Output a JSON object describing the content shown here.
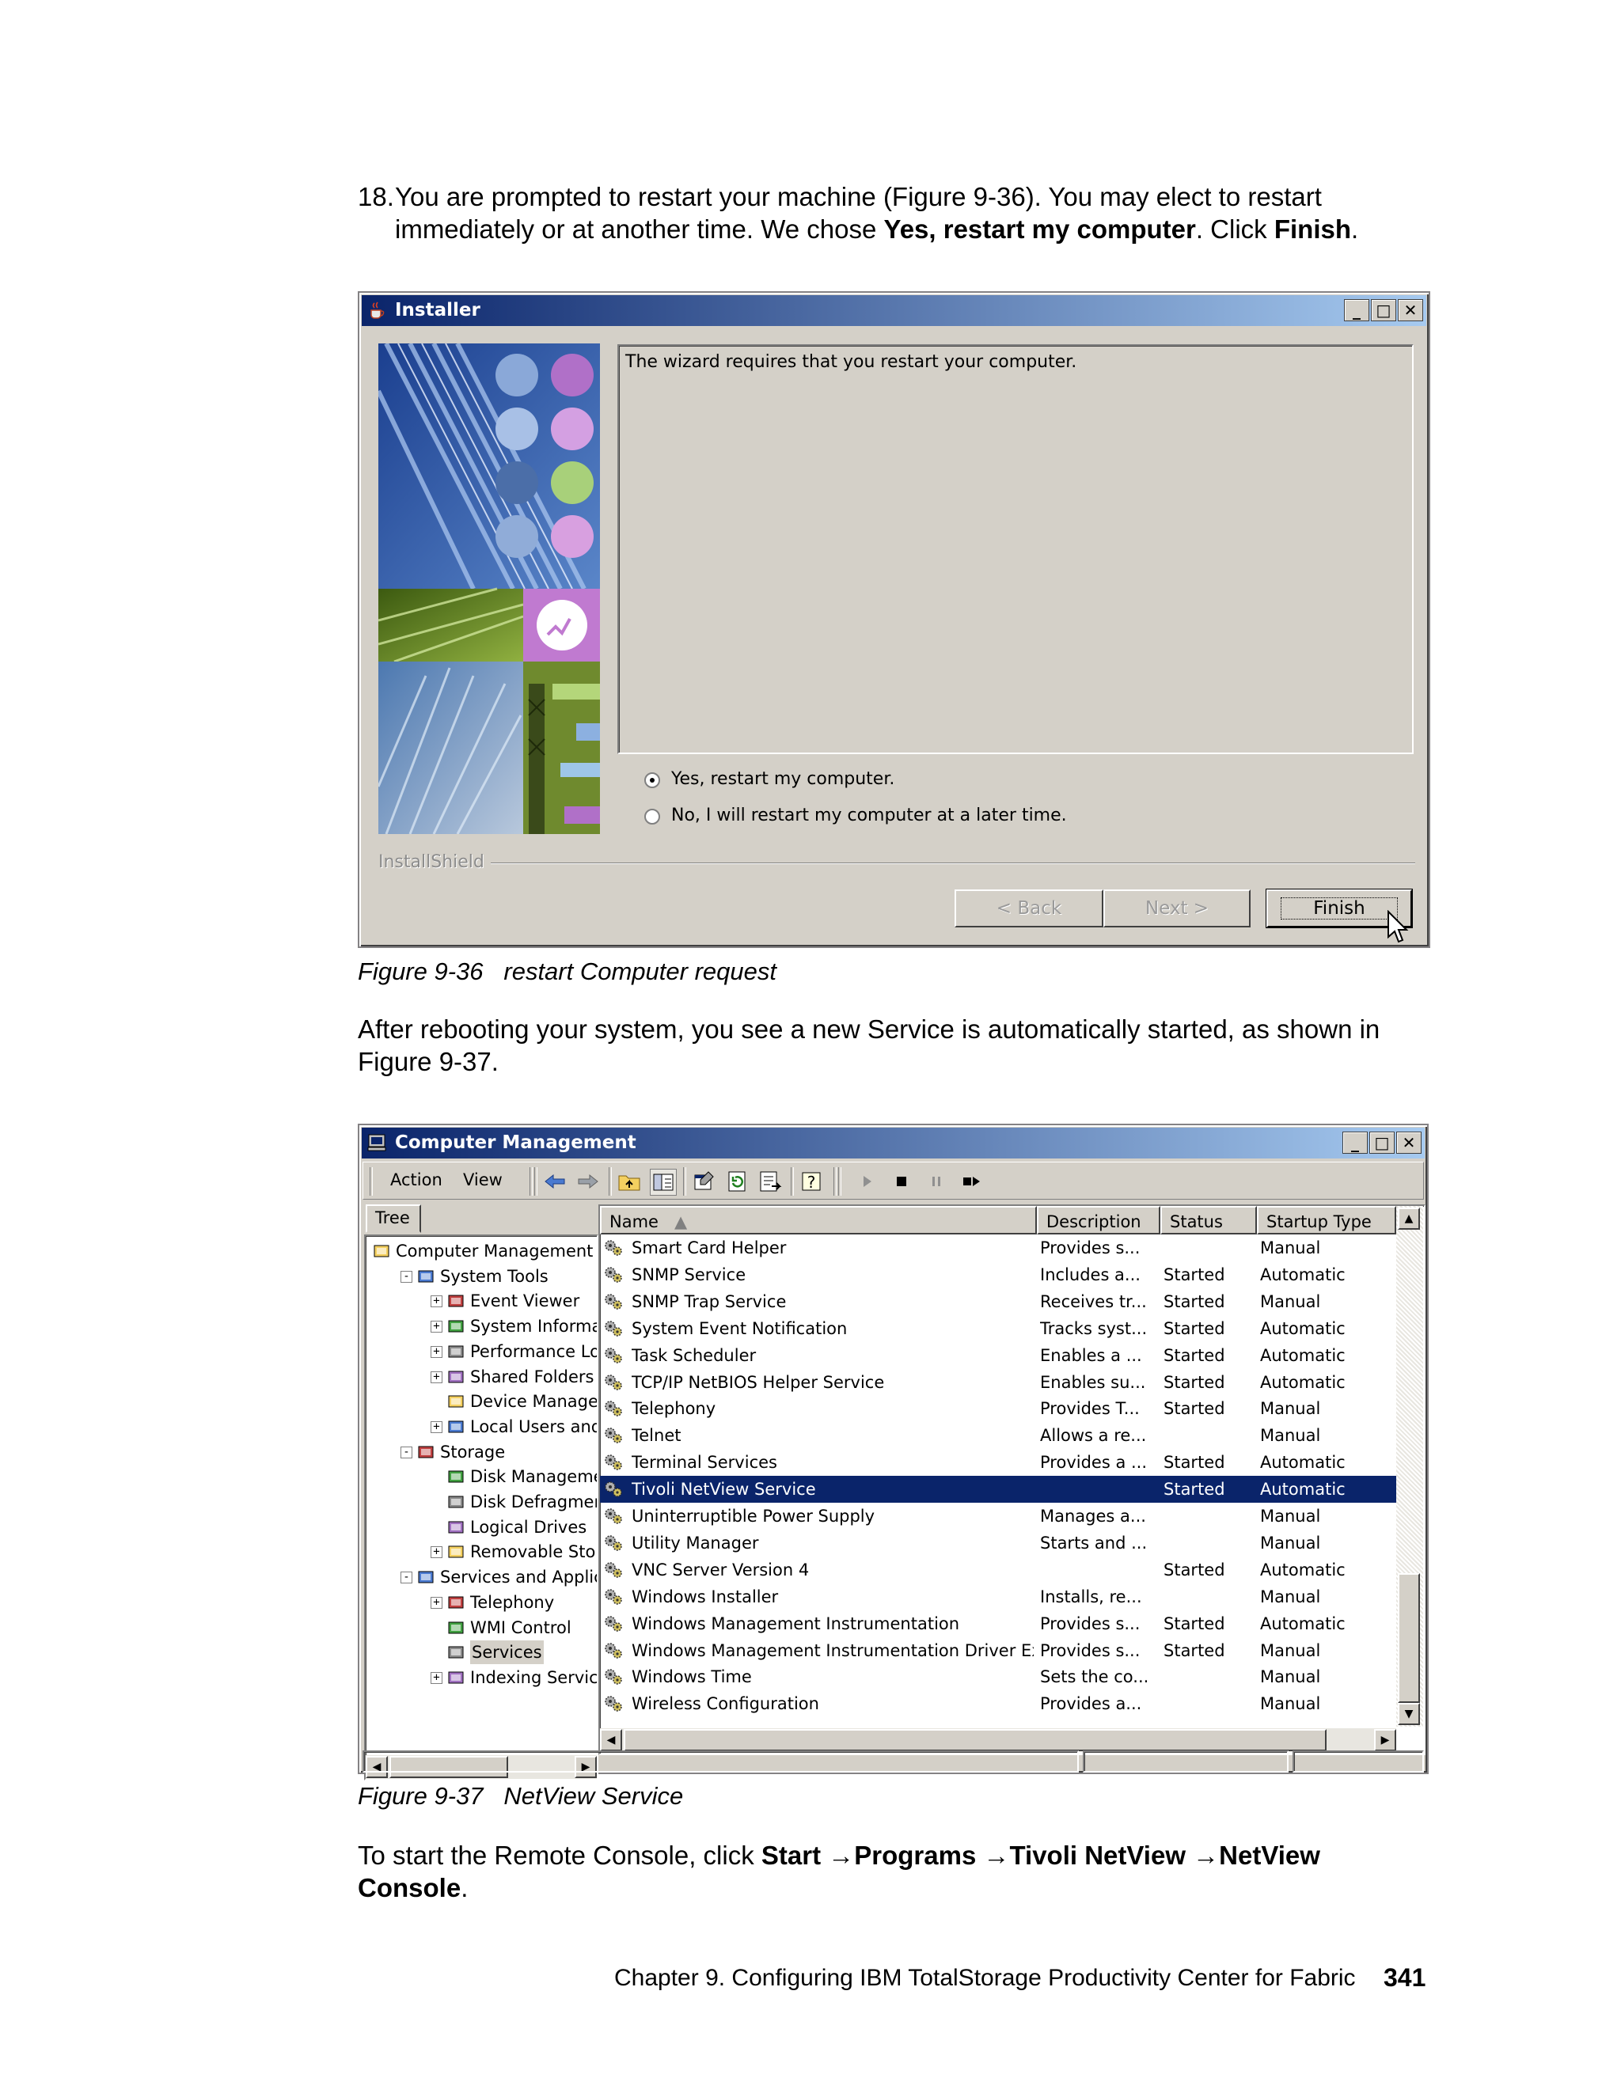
{
  "step18": {
    "number": "18.",
    "line1": "You are prompted to restart your machine (Figure 9-36). You may elect to restart",
    "line2_pre": "immediately or at another time. We chose ",
    "line2_bold": "Yes, restart my computer",
    "line2_mid": ". Click ",
    "line2_bold2": "Finish",
    "line2_end": "."
  },
  "installer": {
    "title": "Installer",
    "message": "The wizard requires that you restart your computer.",
    "radio_yes": "Yes, restart my computer.",
    "radio_no": "No, I will restart my computer at a later time.",
    "brand": "InstallShield",
    "back_label": "< Back",
    "next_label": "Next >",
    "finish_label": "Finish"
  },
  "caption1": {
    "label": "Figure 9-36",
    "text": "restart Computer request"
  },
  "para2": {
    "line1": "After rebooting your system, you see a new Service is automatically started, as shown in",
    "line2": "Figure 9-37."
  },
  "cm": {
    "title": "Computer Management",
    "menu": {
      "action": "Action",
      "view": "View"
    },
    "tree_tab": "Tree",
    "tree": [
      {
        "label": "Computer Management (",
        "level": 0,
        "exp": ""
      },
      {
        "label": "System Tools",
        "level": 1,
        "exp": "-"
      },
      {
        "label": "Event Viewer",
        "level": 2,
        "exp": "+"
      },
      {
        "label": "System Informati",
        "level": 2,
        "exp": "+"
      },
      {
        "label": "Performance Log",
        "level": 2,
        "exp": "+"
      },
      {
        "label": "Shared Folders",
        "level": 2,
        "exp": "+"
      },
      {
        "label": "Device Manager",
        "level": 2,
        "exp": ""
      },
      {
        "label": "Local Users and (",
        "level": 2,
        "exp": "+"
      },
      {
        "label": "Storage",
        "level": 1,
        "exp": "-"
      },
      {
        "label": "Disk Management",
        "level": 2,
        "exp": ""
      },
      {
        "label": "Disk Defragmente",
        "level": 2,
        "exp": ""
      },
      {
        "label": "Logical Drives",
        "level": 2,
        "exp": ""
      },
      {
        "label": "Removable Stora",
        "level": 2,
        "exp": "+"
      },
      {
        "label": "Services and Applicat",
        "level": 1,
        "exp": "-"
      },
      {
        "label": "Telephony",
        "level": 2,
        "exp": "+"
      },
      {
        "label": "WMI Control",
        "level": 2,
        "exp": ""
      },
      {
        "label": "Services",
        "level": 2,
        "exp": "",
        "selected": true
      },
      {
        "label": "Indexing Service",
        "level": 2,
        "exp": "+"
      }
    ],
    "columns": {
      "name": "Name",
      "description": "Description",
      "status": "Status",
      "startup": "Startup Type"
    },
    "rows": [
      {
        "name": "Smart Card Helper",
        "description": "Provides s...",
        "status": "",
        "startup": "Manual"
      },
      {
        "name": "SNMP Service",
        "description": "Includes a...",
        "status": "Started",
        "startup": "Automatic"
      },
      {
        "name": "SNMP Trap Service",
        "description": "Receives tr...",
        "status": "Started",
        "startup": "Manual"
      },
      {
        "name": "System Event Notification",
        "description": "Tracks syst...",
        "status": "Started",
        "startup": "Automatic"
      },
      {
        "name": "Task Scheduler",
        "description": "Enables a ...",
        "status": "Started",
        "startup": "Automatic"
      },
      {
        "name": "TCP/IP NetBIOS Helper Service",
        "description": "Enables su...",
        "status": "Started",
        "startup": "Automatic"
      },
      {
        "name": "Telephony",
        "description": "Provides T...",
        "status": "Started",
        "startup": "Manual"
      },
      {
        "name": "Telnet",
        "description": "Allows a re...",
        "status": "",
        "startup": "Manual"
      },
      {
        "name": "Terminal Services",
        "description": "Provides a ...",
        "status": "Started",
        "startup": "Automatic"
      },
      {
        "name": "Tivoli NetView Service",
        "description": "",
        "status": "Started",
        "startup": "Automatic",
        "selected": true
      },
      {
        "name": "Uninterruptible Power Supply",
        "description": "Manages a...",
        "status": "",
        "startup": "Manual"
      },
      {
        "name": "Utility Manager",
        "description": "Starts and ...",
        "status": "",
        "startup": "Manual"
      },
      {
        "name": "VNC Server Version 4",
        "description": "",
        "status": "Started",
        "startup": "Automatic"
      },
      {
        "name": "Windows Installer",
        "description": "Installs, re...",
        "status": "",
        "startup": "Manual"
      },
      {
        "name": "Windows Management Instrumentation",
        "description": "Provides s...",
        "status": "Started",
        "startup": "Automatic"
      },
      {
        "name": "Windows Management Instrumentation Driver Ext...",
        "description": "Provides s...",
        "status": "Started",
        "startup": "Manual"
      },
      {
        "name": "Windows Time",
        "description": "Sets the co...",
        "status": "",
        "startup": "Manual"
      },
      {
        "name": "Wireless Configuration",
        "description": "Provides a...",
        "status": "",
        "startup": "Manual"
      }
    ]
  },
  "caption2": {
    "label": "Figure 9-37",
    "text": "NetView Service"
  },
  "para3": {
    "pre": "To start the Remote Console, click ",
    "start": "Start",
    "arrow": "→",
    "programs": "Programs",
    "tivoli": "Tivoli NetView",
    "netview": "NetView",
    "console": "Console",
    "end": "."
  },
  "footer": {
    "chapter": "Chapter 9. Configuring IBM TotalStorage Productivity Center for Fabric",
    "page": "341"
  },
  "colors": {
    "titlebar": "#0a246a",
    "selection": "#0a246a",
    "face": "#d4d0c8"
  }
}
